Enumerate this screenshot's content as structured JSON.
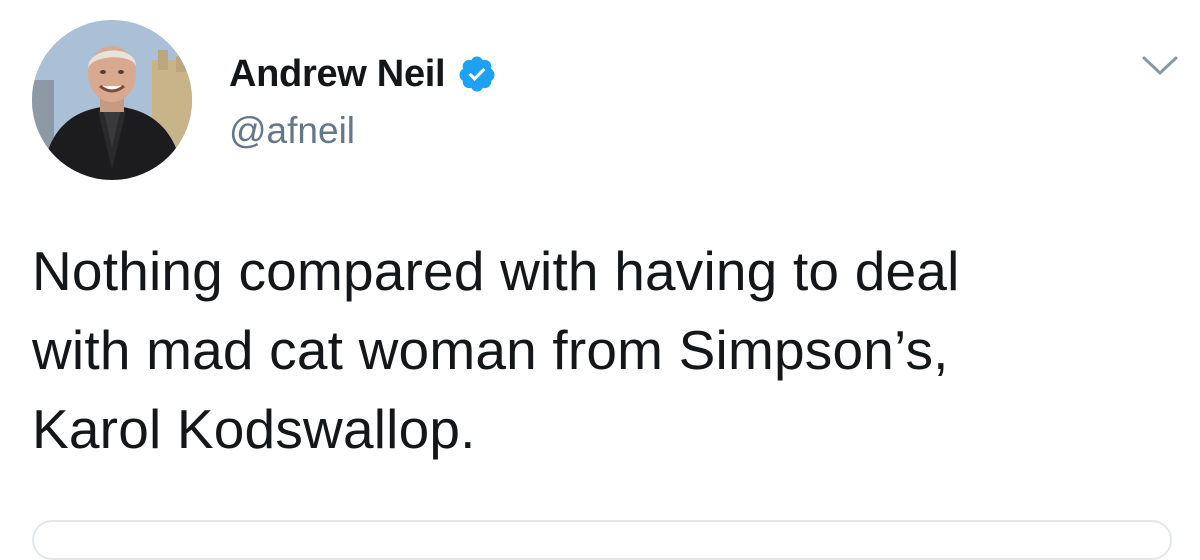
{
  "author": {
    "display_name": "Andrew Neil",
    "handle": "@afneil",
    "verified": true,
    "avatar_icon": "profile-photo"
  },
  "tweet": {
    "text_lines": [
      "Nothing compared with having to deal",
      "with mad cat woman from Simpson’s,",
      "Karol Kodswallop."
    ]
  },
  "icons": {
    "verified": "verified-badge-icon",
    "menu": "chevron-down-icon"
  },
  "colors": {
    "verified_blue": "#1da1f2",
    "handle_gray": "#657786",
    "text": "#14171a"
  }
}
